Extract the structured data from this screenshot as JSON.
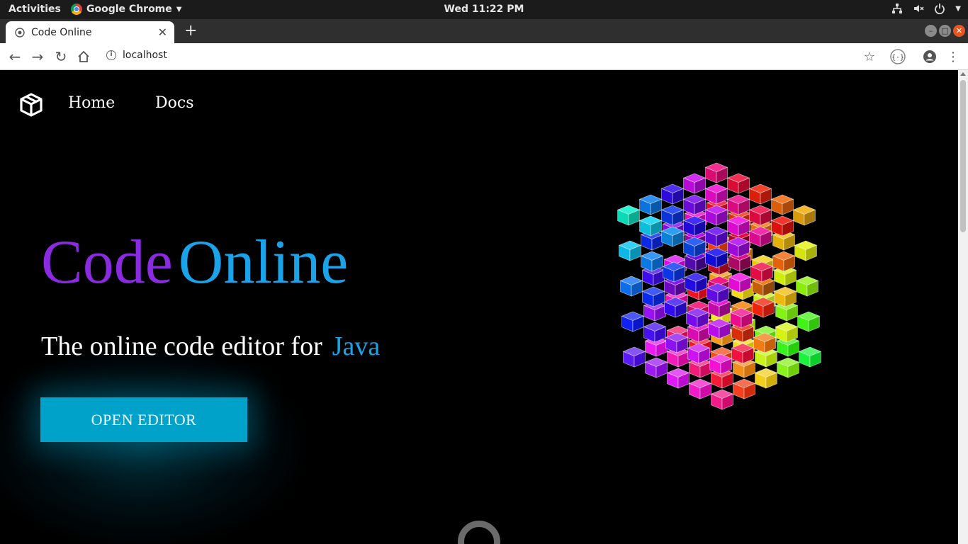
{
  "system_bar": {
    "activities": "Activities",
    "app_name": "Google Chrome",
    "clock": "Wed 11:22 PM"
  },
  "browser": {
    "tab_title": "Code Online",
    "url": "localhost"
  },
  "nav": {
    "links": [
      "Home",
      "Docs"
    ]
  },
  "hero": {
    "title_part1": "Code",
    "title_part2": "Online",
    "tagline": "The online code editor for",
    "language": "Java",
    "button": "OPEN EDITOR"
  },
  "colors": {
    "title_code": "#8a2be2",
    "accent": "#1aa3e8",
    "button_bg": "#00a2c9",
    "page_bg": "#000000"
  },
  "icons": {
    "nav_logo": "cube-logo-icon",
    "loading": "spinner-icon"
  }
}
